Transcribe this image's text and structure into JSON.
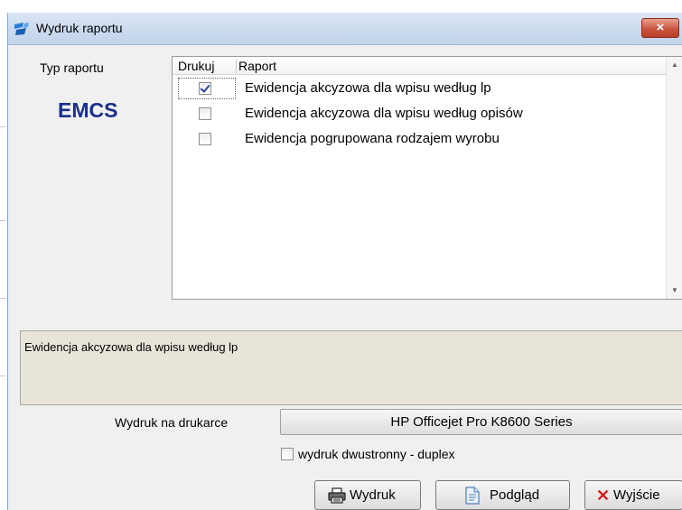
{
  "window": {
    "title": "Wydruk raportu",
    "close_label": "×"
  },
  "report_type": {
    "label": "Typ raportu",
    "value": "EMCS"
  },
  "report_list": {
    "columns": [
      "Drukuj",
      "Raport"
    ],
    "rows": [
      {
        "checked": true,
        "label": "Ewidencja akcyzowa dla wpisu według lp"
      },
      {
        "checked": false,
        "label": "Ewidencja akcyzowa dla wpisu według opisów"
      },
      {
        "checked": false,
        "label": "Ewidencja pogrupowana rodzajem wyrobu"
      }
    ]
  },
  "description": "Ewidencja akcyzowa dla wpisu według lp",
  "printer": {
    "label": "Wydruk na drukarce",
    "name": "HP Officejet Pro K8600 Series"
  },
  "duplex": {
    "checked": false,
    "label": "wydruk dwustronny - duplex"
  },
  "buttons": {
    "print": "Wydruk",
    "preview": "Podgląd",
    "exit": "Wyjście"
  },
  "colors": {
    "accent": "#1b2f8c",
    "description_bg": "#e8e4d8",
    "close": "#c7503a"
  },
  "icons": {
    "title": "app-logo-icon",
    "print": "printer-icon",
    "preview": "document-preview-icon",
    "exit": "x-mark-icon"
  }
}
